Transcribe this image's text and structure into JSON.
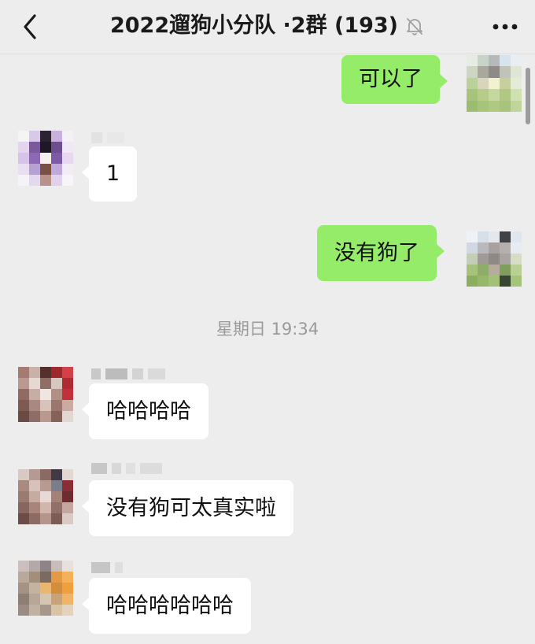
{
  "header": {
    "title": "2022遛狗小分队 ·2群 (193)",
    "back_icon": "chevron-left-icon",
    "mute_icon": "bell-muted-icon",
    "more_icon": "more-dots-icon"
  },
  "colors": {
    "background": "#ededed",
    "incoming_bubble": "#ffffff",
    "outgoing_bubble": "#95ec69",
    "timestamp": "#9a9a9a"
  },
  "messages": [
    {
      "direction": "outgoing",
      "text": "可以了"
    },
    {
      "direction": "incoming",
      "text": "1"
    },
    {
      "direction": "outgoing",
      "text": "没有狗了"
    },
    {
      "type": "timestamp",
      "text": "星期日 19:34"
    },
    {
      "direction": "incoming",
      "text": "哈哈哈哈"
    },
    {
      "direction": "incoming",
      "text": "没有狗可太真实啦"
    },
    {
      "direction": "incoming",
      "text": "哈哈哈哈哈哈"
    }
  ]
}
